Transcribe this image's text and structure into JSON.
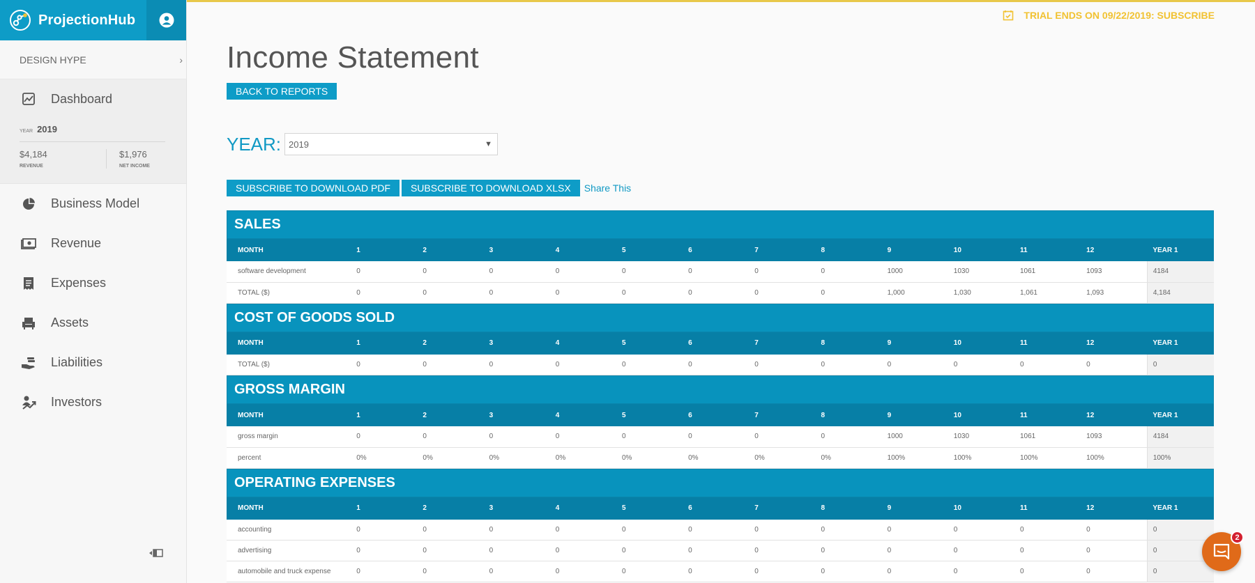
{
  "app": {
    "name": "ProjectionHub"
  },
  "sidebar": {
    "company": "DESIGN HYPE",
    "dashboard": {
      "label": "Dashboard",
      "year_label": "YEAR",
      "year": "2019",
      "revenue_value": "$4,184",
      "revenue_label": "REVENUE",
      "net_income_value": "$1,976",
      "net_income_label": "NET INCOME"
    },
    "items": [
      {
        "label": "Business Model",
        "icon": "pie-chart-icon"
      },
      {
        "label": "Revenue",
        "icon": "cash-icon"
      },
      {
        "label": "Expenses",
        "icon": "receipt-icon"
      },
      {
        "label": "Assets",
        "icon": "armchair-icon"
      },
      {
        "label": "Liabilities",
        "icon": "hand-coins-icon"
      },
      {
        "label": "Investors",
        "icon": "investor-icon"
      }
    ]
  },
  "trial": {
    "text": "TRIAL ENDS ON 09/22/2019: SUBSCRIBE",
    "color": "#f1c232"
  },
  "main": {
    "title": "Income Statement",
    "back_button": "BACK TO REPORTS",
    "year_label": "YEAR:",
    "year_value": "2019",
    "download_pdf": "SUBSCRIBE TO DOWNLOAD PDF",
    "download_xlsx": "SUBSCRIBE TO DOWNLOAD XLSX",
    "share": "Share This"
  },
  "table_header": {
    "month": "MONTH",
    "months": [
      "1",
      "2",
      "3",
      "4",
      "5",
      "6",
      "7",
      "8",
      "9",
      "10",
      "11",
      "12"
    ],
    "year": "YEAR 1"
  },
  "sections": [
    {
      "title": "SALES",
      "rows": [
        {
          "label": "software development",
          "values": [
            "0",
            "0",
            "0",
            "0",
            "0",
            "0",
            "0",
            "0",
            "1000",
            "1030",
            "1061",
            "1093"
          ],
          "year": "4184"
        },
        {
          "label": "TOTAL ($)",
          "values": [
            "0",
            "0",
            "0",
            "0",
            "0",
            "0",
            "0",
            "0",
            "1,000",
            "1,030",
            "1,061",
            "1,093"
          ],
          "year": "4,184"
        }
      ]
    },
    {
      "title": "COST OF GOODS SOLD",
      "rows": [
        {
          "label": "TOTAL ($)",
          "values": [
            "0",
            "0",
            "0",
            "0",
            "0",
            "0",
            "0",
            "0",
            "0",
            "0",
            "0",
            "0"
          ],
          "year": "0"
        }
      ]
    },
    {
      "title": "GROSS MARGIN",
      "rows": [
        {
          "label": "gross margin",
          "values": [
            "0",
            "0",
            "0",
            "0",
            "0",
            "0",
            "0",
            "0",
            "1000",
            "1030",
            "1061",
            "1093"
          ],
          "year": "4184"
        },
        {
          "label": "percent",
          "values": [
            "0%",
            "0%",
            "0%",
            "0%",
            "0%",
            "0%",
            "0%",
            "0%",
            "100%",
            "100%",
            "100%",
            "100%"
          ],
          "year": "100%"
        }
      ]
    },
    {
      "title": "OPERATING EXPENSES",
      "rows": [
        {
          "label": "accounting",
          "values": [
            "0",
            "0",
            "0",
            "0",
            "0",
            "0",
            "0",
            "0",
            "0",
            "0",
            "0",
            "0"
          ],
          "year": "0"
        },
        {
          "label": "advertising",
          "values": [
            "0",
            "0",
            "0",
            "0",
            "0",
            "0",
            "0",
            "0",
            "0",
            "0",
            "0",
            "0"
          ],
          "year": "0"
        },
        {
          "label": "automobile and truck expense",
          "values": [
            "0",
            "0",
            "0",
            "0",
            "0",
            "0",
            "0",
            "0",
            "0",
            "0",
            "0",
            "0"
          ],
          "year": "0"
        }
      ]
    }
  ],
  "chat": {
    "badge": "2"
  },
  "colors": {
    "primary": "#0e9cc7",
    "header": "#077fa6",
    "accent": "#e8c84a",
    "chat": "#e06a19"
  }
}
